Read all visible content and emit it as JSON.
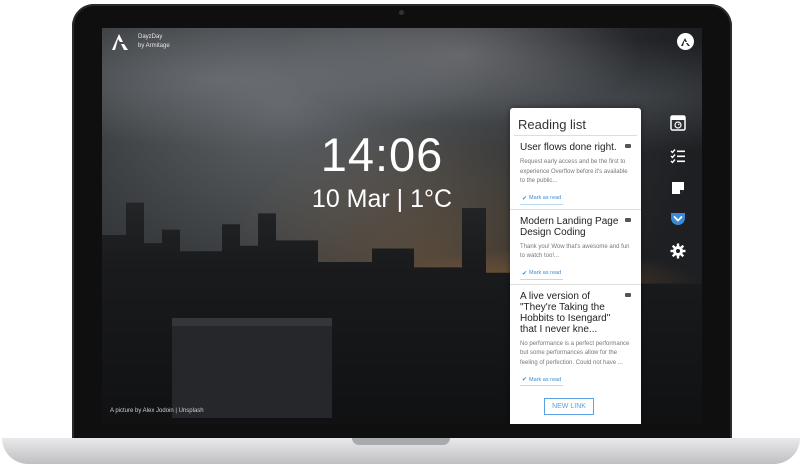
{
  "app": {
    "name": "DayzDay",
    "subtitle": "by Armitage"
  },
  "clock": {
    "time": "14:06",
    "date_weather": "10 Mar | 1°C"
  },
  "credit": "A picture by Alex Jodoin | Unsplash",
  "reading_list": {
    "title": "Reading list",
    "items": [
      {
        "title": "User flows done right.",
        "description": "Request early access and be the first to experience Overflow before it's available to the public...",
        "action": "Mark as read"
      },
      {
        "title": "Modern Landing Page Design Coding",
        "description": "Thank you! Wow that's awesome and fun to watch too!...",
        "action": "Mark as read"
      },
      {
        "title": "A live version of \"They're Taking the Hobbits to Isengard\" that I never kne...",
        "description": "No performance is a perfect performance but some performances allow for the feeling of perfection. Could not have ...",
        "action": "Mark as read"
      }
    ],
    "new_link_label": "NEW LINK"
  },
  "toolbar": {
    "icons": [
      "calendar-clock-icon",
      "checklist-icon",
      "note-icon",
      "pocket-icon",
      "gear-icon"
    ],
    "active_color": "#3a8bd6"
  }
}
